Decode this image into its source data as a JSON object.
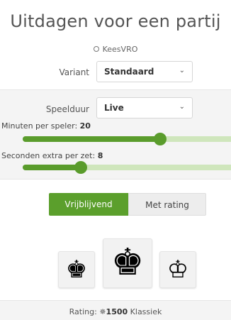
{
  "title": "Uitdagen voor een partij",
  "opponent": {
    "name": "KeesVRO",
    "icon": "circle-outline-icon"
  },
  "variant": {
    "label": "Variant",
    "value": "Standaard"
  },
  "time_control": {
    "label": "Speelduur",
    "value": "Live"
  },
  "minutes": {
    "label": "Minuten per speler:",
    "value": "20",
    "fill_fraction": 0.66
  },
  "increment": {
    "label": "Seconden extra per zet:",
    "value": "8",
    "fill_fraction": 0.28
  },
  "mode_toggle": {
    "casual": "Vrijblijvend",
    "rated": "Met rating",
    "selected": "casual"
  },
  "colors": {
    "accent_green": "#5b9f2c",
    "slider_track": "#cfe6bc",
    "panel_bg": "#f4f4f4"
  },
  "color_choices": [
    {
      "name": "black",
      "glyph": "♚"
    },
    {
      "name": "random",
      "glyph": "♚"
    },
    {
      "name": "white",
      "glyph": "♔"
    }
  ],
  "footer": {
    "prefix": "Rating:",
    "icon": "fide-star-icon",
    "rating": "1500",
    "category": "Klassiek"
  }
}
